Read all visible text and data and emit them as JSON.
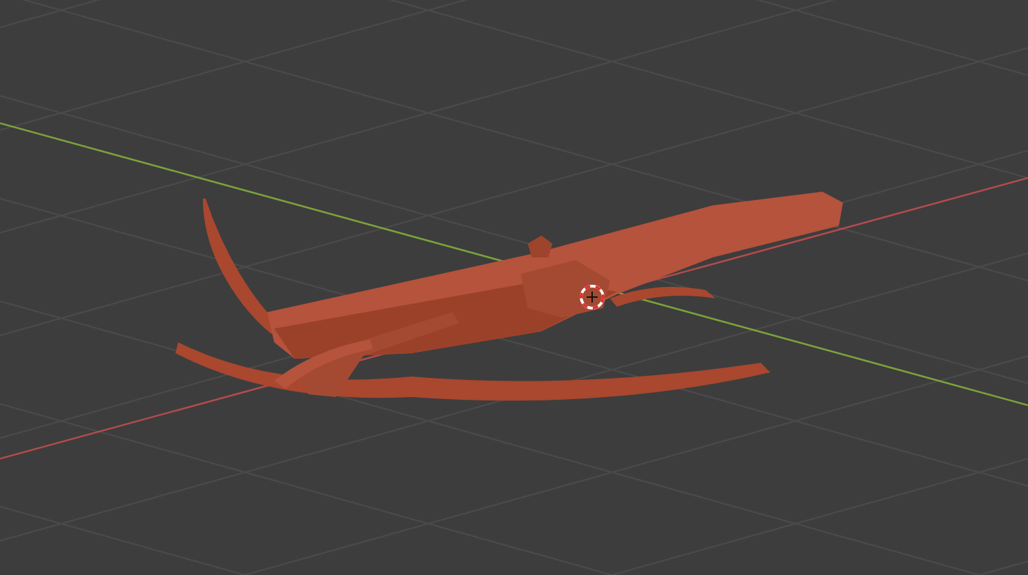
{
  "viewport": {
    "show_grid": true,
    "show_axes": true,
    "cursor_visible": true
  }
}
